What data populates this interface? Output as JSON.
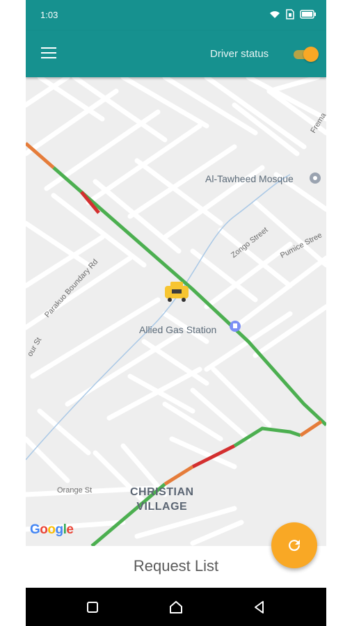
{
  "status_bar": {
    "time": "1:03",
    "icons": [
      "wifi-icon",
      "sim-icon",
      "battery-icon"
    ]
  },
  "app_bar": {
    "menu_icon": "hamburger-menu-icon",
    "driver_status_label": "Driver status",
    "driver_status_on": true
  },
  "map": {
    "labels": {
      "mosque": "Al-Tawheed Mosque",
      "gas_station": "Allied Gas Station",
      "zongo": "Zongo Street",
      "pumice": "Pumice Stree",
      "parakuo": "Parakuo Boundary Rd",
      "frema": "Frema",
      "our_st": "our St",
      "orange": "Orange St",
      "village_line1": "CHRISTIAN",
      "village_line2": "VILLAGE"
    },
    "attribution": [
      "G",
      "o",
      "o",
      "g",
      "l",
      "e"
    ],
    "vehicle_icon": "taxi-icon"
  },
  "fab": {
    "icon": "refresh-icon"
  },
  "bottom": {
    "request_list_label": "Request List"
  },
  "nav": {
    "icons": [
      "recent-apps-icon",
      "home-icon",
      "back-icon"
    ]
  },
  "colors": {
    "primary": "#16918f",
    "accent": "#f9a825",
    "traffic_green": "#4caf50",
    "traffic_orange": "#e57c3a",
    "traffic_red": "#d32f2f"
  }
}
